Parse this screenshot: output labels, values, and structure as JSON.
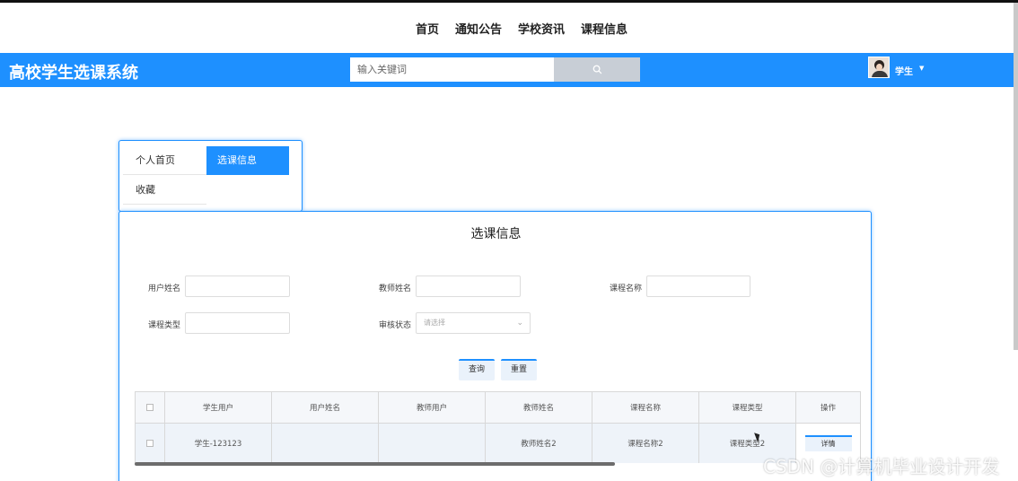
{
  "nav": {
    "items": [
      "首页",
      "通知公告",
      "学校资讯",
      "课程信息"
    ]
  },
  "header": {
    "brand": "高校学生选课系统",
    "search_placeholder": "输入关键词",
    "user_name": "学生",
    "accent_color": "#1e90ff"
  },
  "menu": {
    "home": "个人首页",
    "selection": "选课信息",
    "favorites": "收藏"
  },
  "panel": {
    "title": "选课信息",
    "filters": {
      "user_name_label": "用户姓名",
      "teacher_name_label": "教师姓名",
      "course_name_label": "课程名称",
      "course_type_label": "课程类型",
      "review_status_label": "审核状态",
      "review_status_placeholder": "请选择"
    },
    "query_label": "查询",
    "reset_label": "重置"
  },
  "table": {
    "columns": [
      "学生用户",
      "用户姓名",
      "教师用户",
      "教师姓名",
      "课程名称",
      "课程类型",
      "操作"
    ],
    "rows": [
      {
        "student_user": "学生-123123",
        "user_name": "",
        "teacher_user": "",
        "teacher_name": "教师姓名2",
        "course_name": "课程名称2",
        "course_type": "课程类型2",
        "action": "详情"
      }
    ]
  },
  "watermark": "CSDN @计算机毕业设计开发"
}
